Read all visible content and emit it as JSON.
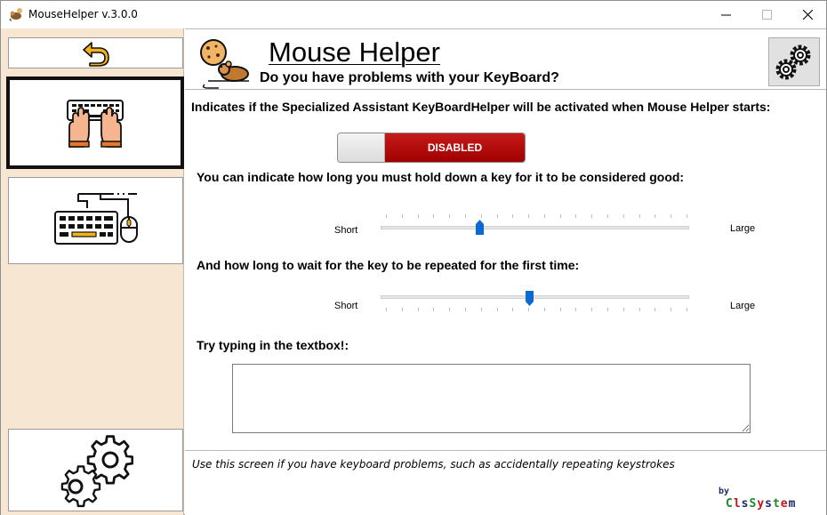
{
  "window": {
    "title": "MouseHelper v.3.0.0",
    "controls": {
      "minimize": "—",
      "maximize": "☐",
      "close": "✕"
    }
  },
  "sidebar": {
    "items": [
      {
        "name": "back-button",
        "icon": "undo-arrow-icon"
      },
      {
        "name": "keyboard-hands",
        "icon": "keyboard-hands-icon",
        "selected": true
      },
      {
        "name": "keyboard-mouse",
        "icon": "keyboard-mouse-icon"
      },
      {
        "name": "settings",
        "icon": "gears-icon"
      }
    ]
  },
  "header": {
    "app_name": "Mouse Helper",
    "subtitle": "Do you have problems with your KeyBoard?",
    "logo_icon": "mouse-cookie-icon",
    "settings_icon": "gears-icon"
  },
  "main": {
    "activate_label": "Indicates if the Specialized Assistant KeyBoardHelper will be activated when Mouse Helper starts:",
    "toggle": {
      "state_label": "DISABLED",
      "enabled": false
    },
    "hold_label": "You can indicate how long you must hold down a key for it to be considered good:",
    "hold_slider": {
      "min_label": "Short",
      "max_label": "Large",
      "ticks": 20,
      "value": 0.32
    },
    "wait_label": "And how long to wait for the key to be repeated for the first time:",
    "wait_slider": {
      "min_label": "Short",
      "max_label": "Large",
      "ticks": 20,
      "value": 0.48
    },
    "try_label": "Try typing in the textbox!:",
    "textbox_value": ""
  },
  "footer": {
    "info": "Use this screen if you have keyboard problems, such as accidentally repeating keystrokes",
    "by": "by",
    "brand": [
      {
        "ch": "C",
        "color": "#1a8a2a"
      },
      {
        "ch": "l",
        "color": "#c0161b"
      },
      {
        "ch": "s",
        "color": "#1b2a6a"
      },
      {
        "ch": "S",
        "color": "#1a8a2a"
      },
      {
        "ch": "y",
        "color": "#c0161b"
      },
      {
        "ch": "s",
        "color": "#1b2a6a"
      },
      {
        "ch": "t",
        "color": "#1a8a2a"
      },
      {
        "ch": "e",
        "color": "#c0161b"
      },
      {
        "ch": "m",
        "color": "#1b2a6a"
      }
    ]
  },
  "colors": {
    "sidebar_bg": "#f7e6d2",
    "toggle_off": "#b30d0d",
    "slider_thumb": "#0a6ad1",
    "accent_orange": "#f4a34a"
  }
}
